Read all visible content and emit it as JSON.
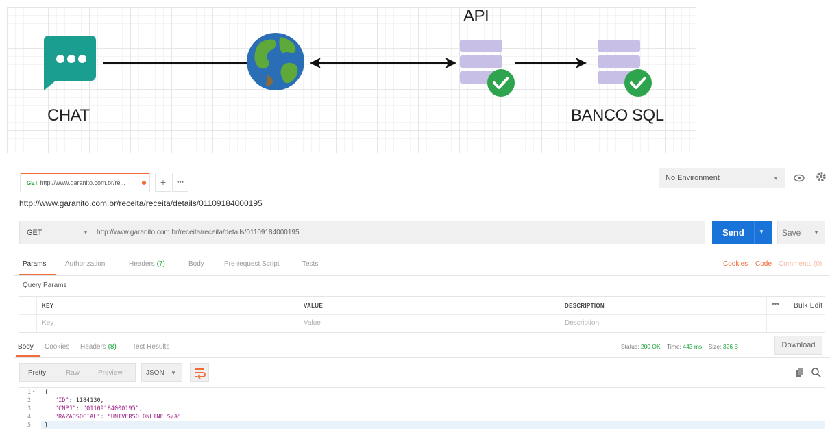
{
  "diagram": {
    "chat_label": "CHAT",
    "api_label": "API",
    "db_label": "BANCO SQL",
    "icons": [
      "chat-bubble-icon",
      "globe-icon",
      "server-icon",
      "check-icon",
      "database-icon"
    ],
    "colors": {
      "chat": "#1a9e8f",
      "server": "#c7bfe6",
      "check": "#2ea44f",
      "globe": "#2a6fb6"
    }
  },
  "tabs": {
    "active_method": "GET",
    "active_title": "http://www.garanito.com.br/re...",
    "add_label": "+",
    "more_label": "•••"
  },
  "environment": {
    "selected": "No Environment"
  },
  "request": {
    "title": "http://www.garanito.com.br/receita/receita/details/01109184000195",
    "method": "GET",
    "url": "http://www.garanito.com.br/receita/receita/details/01109184000195",
    "send_label": "Send",
    "save_label": "Save"
  },
  "request_tabs": {
    "params": "Params",
    "authorization": "Authorization",
    "headers": "Headers",
    "headers_count": "(7)",
    "body": "Body",
    "prerequest": "Pre-request Script",
    "tests": "Tests",
    "cookies": "Cookies",
    "code": "Code",
    "comments": "Comments (0)"
  },
  "query_params": {
    "title": "Query Params",
    "col_key": "KEY",
    "col_value": "VALUE",
    "col_description": "DESCRIPTION",
    "more": "•••",
    "bulk_edit": "Bulk Edit",
    "placeholder_key": "Key",
    "placeholder_value": "Value",
    "placeholder_description": "Description"
  },
  "response_tabs": {
    "body": "Body",
    "cookies": "Cookies",
    "headers": "Headers",
    "headers_count": "(8)",
    "test_results": "Test Results"
  },
  "response_status": {
    "status_label": "Status:",
    "status_value": "200 OK",
    "time_label": "Time:",
    "time_value": "443 ms",
    "size_label": "Size:",
    "size_value": "326 B",
    "download_label": "Download"
  },
  "format_bar": {
    "pretty": "Pretty",
    "raw": "Raw",
    "preview": "Preview",
    "format": "JSON"
  },
  "response_body": {
    "lines": [
      {
        "n": "1",
        "text": "{"
      },
      {
        "n": "2",
        "key": "\"ID\"",
        "value": "1184130,"
      },
      {
        "n": "3",
        "key": "\"CNPJ\"",
        "value": "\"01109184000195\","
      },
      {
        "n": "4",
        "key": "\"RAZAOSOCIAL\"",
        "value": "\"UNIVERSO ONLINE S/A\""
      },
      {
        "n": "5",
        "text": "}"
      }
    ]
  }
}
